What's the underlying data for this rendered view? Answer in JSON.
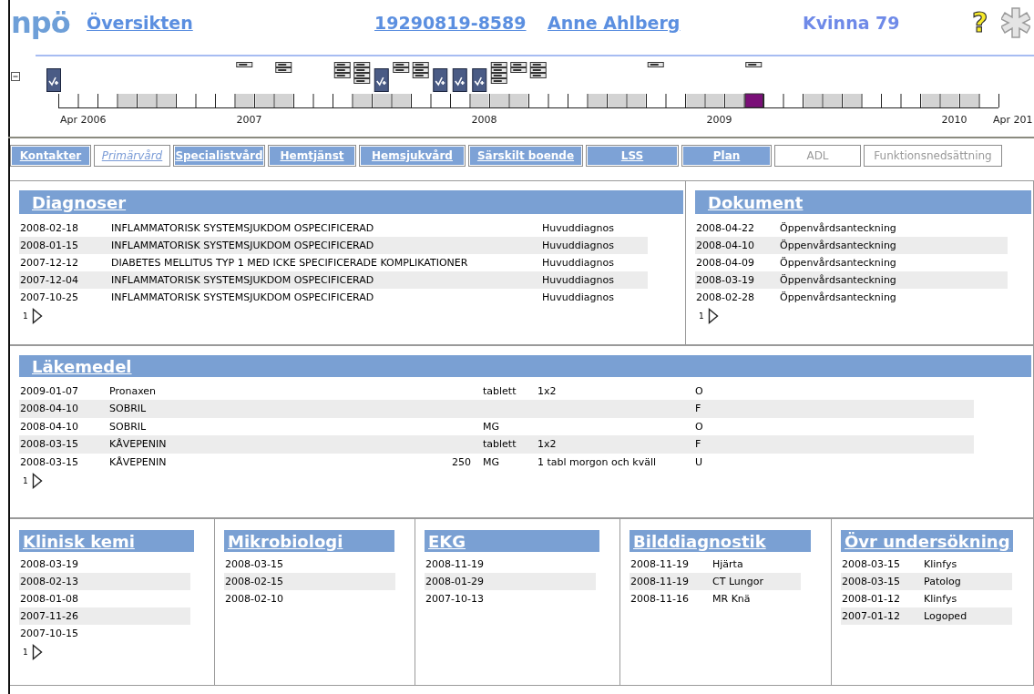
{
  "header": {
    "logo": "npö",
    "title": "Översikten",
    "personnummer": "19290819-8589",
    "patient_name": "Anne Ahlberg",
    "gender_age": "Kvinna 79",
    "help": "?"
  },
  "timeline": {
    "expanded": true,
    "lead_events": [
      {
        "kind": "visit"
      }
    ],
    "end_label": "Apr 201",
    "cells": [
      {
        "kind": "empty",
        "label": "Apr 2006"
      },
      {
        "kind": "empty"
      },
      {
        "kind": "empty"
      },
      {
        "kind": "shaded"
      },
      {
        "kind": "shaded"
      },
      {
        "kind": "shaded"
      },
      {
        "kind": "empty"
      },
      {
        "kind": "empty"
      },
      {
        "kind": "empty"
      },
      {
        "kind": "shaded",
        "label": "2007",
        "events": [
          {
            "kind": "note"
          }
        ]
      },
      {
        "kind": "shaded"
      },
      {
        "kind": "shaded",
        "events": [
          {
            "kind": "note"
          },
          {
            "kind": "note"
          }
        ]
      },
      {
        "kind": "empty"
      },
      {
        "kind": "empty"
      },
      {
        "kind": "empty",
        "events": [
          {
            "kind": "note"
          },
          {
            "kind": "note"
          },
          {
            "kind": "note"
          }
        ]
      },
      {
        "kind": "shaded",
        "events": [
          {
            "kind": "note"
          },
          {
            "kind": "note"
          },
          {
            "kind": "note"
          },
          {
            "kind": "note"
          }
        ]
      },
      {
        "kind": "shaded",
        "events": [
          {
            "kind": "visit"
          }
        ]
      },
      {
        "kind": "shaded",
        "events": [
          {
            "kind": "note"
          },
          {
            "kind": "note"
          }
        ]
      },
      {
        "kind": "empty",
        "events": [
          {
            "kind": "note"
          },
          {
            "kind": "note"
          },
          {
            "kind": "note"
          }
        ]
      },
      {
        "kind": "empty",
        "events": [
          {
            "kind": "visit"
          }
        ]
      },
      {
        "kind": "empty",
        "events": [
          {
            "kind": "visit"
          }
        ]
      },
      {
        "kind": "shaded",
        "label": "2008",
        "events": [
          {
            "kind": "visit"
          }
        ]
      },
      {
        "kind": "shaded",
        "events": [
          {
            "kind": "note"
          },
          {
            "kind": "note"
          },
          {
            "kind": "note"
          },
          {
            "kind": "note"
          }
        ]
      },
      {
        "kind": "shaded",
        "events": [
          {
            "kind": "note"
          },
          {
            "kind": "note"
          }
        ]
      },
      {
        "kind": "empty",
        "events": [
          {
            "kind": "note"
          },
          {
            "kind": "note"
          },
          {
            "kind": "note"
          }
        ]
      },
      {
        "kind": "empty"
      },
      {
        "kind": "empty"
      },
      {
        "kind": "shaded"
      },
      {
        "kind": "shaded"
      },
      {
        "kind": "shaded"
      },
      {
        "kind": "empty",
        "events": [
          {
            "kind": "note"
          }
        ]
      },
      {
        "kind": "empty"
      },
      {
        "kind": "shaded"
      },
      {
        "kind": "shaded",
        "label": "2009"
      },
      {
        "kind": "shaded"
      },
      {
        "kind": "current",
        "events": [
          {
            "kind": "note"
          }
        ]
      },
      {
        "kind": "empty"
      },
      {
        "kind": "empty"
      },
      {
        "kind": "shaded"
      },
      {
        "kind": "shaded"
      },
      {
        "kind": "shaded"
      },
      {
        "kind": "empty"
      },
      {
        "kind": "empty"
      },
      {
        "kind": "empty"
      },
      {
        "kind": "shaded"
      },
      {
        "kind": "shaded",
        "label": "2010"
      },
      {
        "kind": "shaded"
      },
      {
        "kind": "empty"
      }
    ]
  },
  "tabs": [
    {
      "label": "Kontakter",
      "selected": false,
      "disabled": false
    },
    {
      "label": "Primärvård",
      "selected": true,
      "disabled": false
    },
    {
      "label": "Specialistvård",
      "selected": false,
      "disabled": false
    },
    {
      "label": "Hemtjänst",
      "selected": false,
      "disabled": false
    },
    {
      "label": "Hemsjukvård",
      "selected": false,
      "disabled": false
    },
    {
      "label": "Särskilt boende",
      "selected": false,
      "disabled": false
    },
    {
      "label": "LSS",
      "selected": false,
      "disabled": false
    },
    {
      "label": "Plan",
      "selected": false,
      "disabled": false
    },
    {
      "label": "ADL",
      "selected": false,
      "disabled": true
    },
    {
      "label": "Funktionsnedsättning",
      "selected": false,
      "disabled": true
    }
  ],
  "panels": [
    {
      "kind": "diagnoses",
      "title": "Diagnoser",
      "page": "1",
      "rows": [
        {
          "date": "2008-02-18",
          "text": "INFLAMMATORISK SYSTEMSJUKDOM OSPECIFICERAD",
          "type": "Huvuddiagnos"
        },
        {
          "date": "2008-01-15",
          "text": "INFLAMMATORISK SYSTEMSJUKDOM OSPECIFICERAD",
          "type": "Huvuddiagnos"
        },
        {
          "date": "2007-12-12",
          "text": "DIABETES MELLITUS TYP 1 MED ICKE SPECIFICERADE KOMPLIKATIONER",
          "type": "Huvuddiagnos"
        },
        {
          "date": "2007-12-04",
          "text": "INFLAMMATORISK SYSTEMSJUKDOM OSPECIFICERAD",
          "type": "Huvuddiagnos"
        },
        {
          "date": "2007-10-25",
          "text": "INFLAMMATORISK SYSTEMSJUKDOM OSPECIFICERAD",
          "type": "Huvuddiagnos"
        }
      ]
    },
    {
      "kind": "documents",
      "title": "Dokument",
      "page": "1",
      "rows": [
        {
          "date": "2008-04-22",
          "text": "Öppenvårdsanteckning"
        },
        {
          "date": "2008-04-10",
          "text": "Öppenvårdsanteckning"
        },
        {
          "date": "2008-04-09",
          "text": "Öppenvårdsanteckning"
        },
        {
          "date": "2008-03-19",
          "text": "Öppenvårdsanteckning"
        },
        {
          "date": "2008-02-28",
          "text": "Öppenvårdsanteckning"
        }
      ]
    },
    {
      "kind": "medications",
      "title": "Läkemedel",
      "page": "1",
      "rows": [
        {
          "date": "2009-01-07",
          "name": "Pronaxen",
          "unit": "tablett",
          "dosage": "1x2",
          "code": "O"
        },
        {
          "date": "2008-04-10",
          "name": "SOBRIL",
          "code": "F"
        },
        {
          "date": "2008-04-10",
          "name": "SOBRIL",
          "unit": "MG",
          "code": "O"
        },
        {
          "date": "2008-03-15",
          "name": "KÅVEPENIN",
          "unit": "tablett",
          "dosage": "1x2",
          "code": "F"
        },
        {
          "date": "2008-03-15",
          "name": "KÅVEPENIN",
          "strength": "250",
          "unit": "MG",
          "dosage": "1 tabl morgon och kväll",
          "code": "U"
        }
      ]
    },
    {
      "kind": "results",
      "title": "Klinisk kemi",
      "page": "1",
      "rows": [
        {
          "date": "2008-03-19"
        },
        {
          "date": "2008-02-13"
        },
        {
          "date": "2008-01-08"
        },
        {
          "date": "2007-11-26"
        },
        {
          "date": "2007-10-15"
        }
      ]
    },
    {
      "kind": "results",
      "title": "Mikrobiologi",
      "rows": [
        {
          "date": "2008-03-15"
        },
        {
          "date": "2008-02-15"
        },
        {
          "date": "2008-02-10"
        }
      ]
    },
    {
      "kind": "results",
      "title": "EKG",
      "rows": [
        {
          "date": "2008-11-19"
        },
        {
          "date": "2008-01-29"
        },
        {
          "date": "2007-10-13"
        }
      ]
    },
    {
      "kind": "results",
      "title": "Bilddiagnostik",
      "rows": [
        {
          "date": "2008-11-19",
          "text": "Hjärta"
        },
        {
          "date": "2008-11-19",
          "text": "CT Lungor"
        },
        {
          "date": "2008-11-16",
          "text": "MR Knä"
        }
      ]
    },
    {
      "kind": "results",
      "title": "Övr undersökning",
      "rows": [
        {
          "date": "2008-03-15",
          "text": "Klinfys"
        },
        {
          "date": "2008-03-15",
          "text": "Patolog"
        },
        {
          "date": "2008-01-12",
          "text": "Klinfys"
        },
        {
          "date": "2007-01-12",
          "text": "Logoped"
        }
      ]
    }
  ]
}
